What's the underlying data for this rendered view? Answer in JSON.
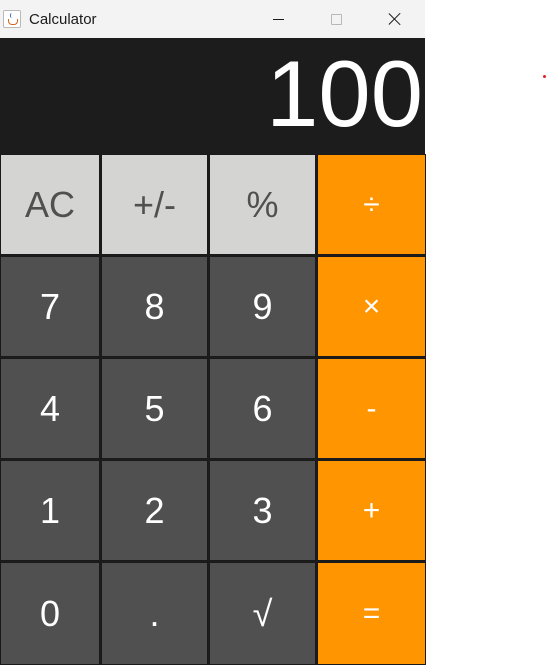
{
  "window": {
    "title": "Calculator",
    "controls": [
      "minimize-icon",
      "maximize-icon",
      "close-icon"
    ]
  },
  "display": {
    "value": "100"
  },
  "keypad": {
    "rows": [
      [
        {
          "label": "AC",
          "kind": "func"
        },
        {
          "label": "+/-",
          "kind": "func"
        },
        {
          "label": "%",
          "kind": "func"
        },
        {
          "label": "÷",
          "kind": "op"
        }
      ],
      [
        {
          "label": "7",
          "kind": "num"
        },
        {
          "label": "8",
          "kind": "num"
        },
        {
          "label": "9",
          "kind": "num"
        },
        {
          "label": "×",
          "kind": "op"
        }
      ],
      [
        {
          "label": "4",
          "kind": "num"
        },
        {
          "label": "5",
          "kind": "num"
        },
        {
          "label": "6",
          "kind": "num"
        },
        {
          "label": "-",
          "kind": "op"
        }
      ],
      [
        {
          "label": "1",
          "kind": "num"
        },
        {
          "label": "2",
          "kind": "num"
        },
        {
          "label": "3",
          "kind": "num"
        },
        {
          "label": "+",
          "kind": "op"
        }
      ],
      [
        {
          "label": "0",
          "kind": "num"
        },
        {
          "label": ".",
          "kind": "num"
        },
        {
          "label": "√",
          "kind": "num"
        },
        {
          "label": "=",
          "kind": "op"
        }
      ]
    ]
  },
  "colors": {
    "display_bg": "#1c1c1c",
    "func_key": "#d4d4d2",
    "num_key": "#505050",
    "op_key": "#ff9500",
    "text_light": "#ffffff",
    "text_dark": "#505050"
  }
}
